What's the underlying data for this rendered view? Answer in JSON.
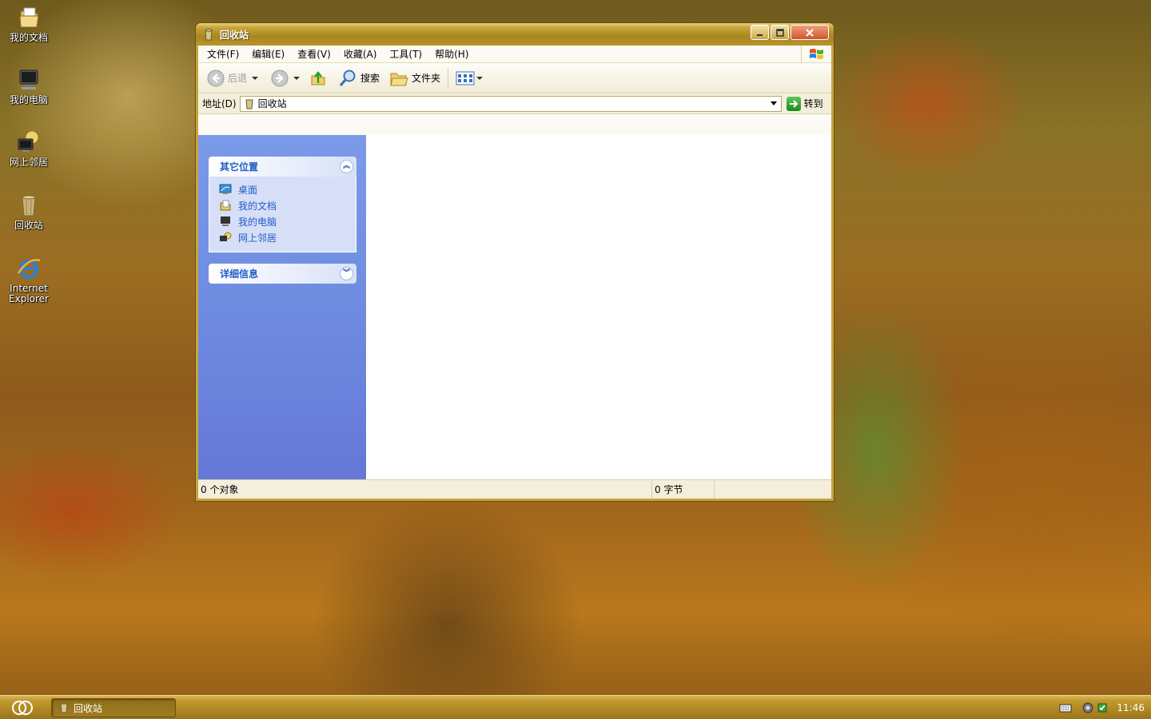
{
  "desktop": {
    "icons": [
      {
        "label": "我的文档",
        "icon": "my-documents-icon"
      },
      {
        "label": "我的电脑",
        "icon": "my-computer-icon"
      },
      {
        "label": "网上邻居",
        "icon": "network-places-icon"
      },
      {
        "label": "回收站",
        "icon": "recycle-bin-icon"
      },
      {
        "label_line1": "Internet",
        "label_line2": "Explorer",
        "icon": "internet-explorer-icon"
      }
    ]
  },
  "window": {
    "title": "回收站",
    "menu": [
      "文件(F)",
      "编辑(E)",
      "查看(V)",
      "收藏(A)",
      "工具(T)",
      "帮助(H)"
    ],
    "toolbar": {
      "back": "后退",
      "search": "搜索",
      "folders": "文件夹"
    },
    "address": {
      "label": "地址(D)",
      "value": "回收站",
      "go": "转到"
    },
    "taskpane": {
      "other_places": {
        "title": "其它位置",
        "links": [
          {
            "label": "桌面",
            "icon": "desktop-icon"
          },
          {
            "label": "我的文档",
            "icon": "my-documents-icon"
          },
          {
            "label": "我的电脑",
            "icon": "my-computer-icon"
          },
          {
            "label": "网上邻居",
            "icon": "network-places-icon"
          }
        ]
      },
      "details": {
        "title": "详细信息"
      }
    },
    "status": {
      "objects": "0 个对象",
      "size": "0 字节"
    }
  },
  "taskbar": {
    "task_label": "回收站",
    "clock": "11:46"
  },
  "colors": {
    "taskpane_blue": "#6f8ce0",
    "link_blue": "#215dc6",
    "titlebar_gold": "#a98520"
  }
}
